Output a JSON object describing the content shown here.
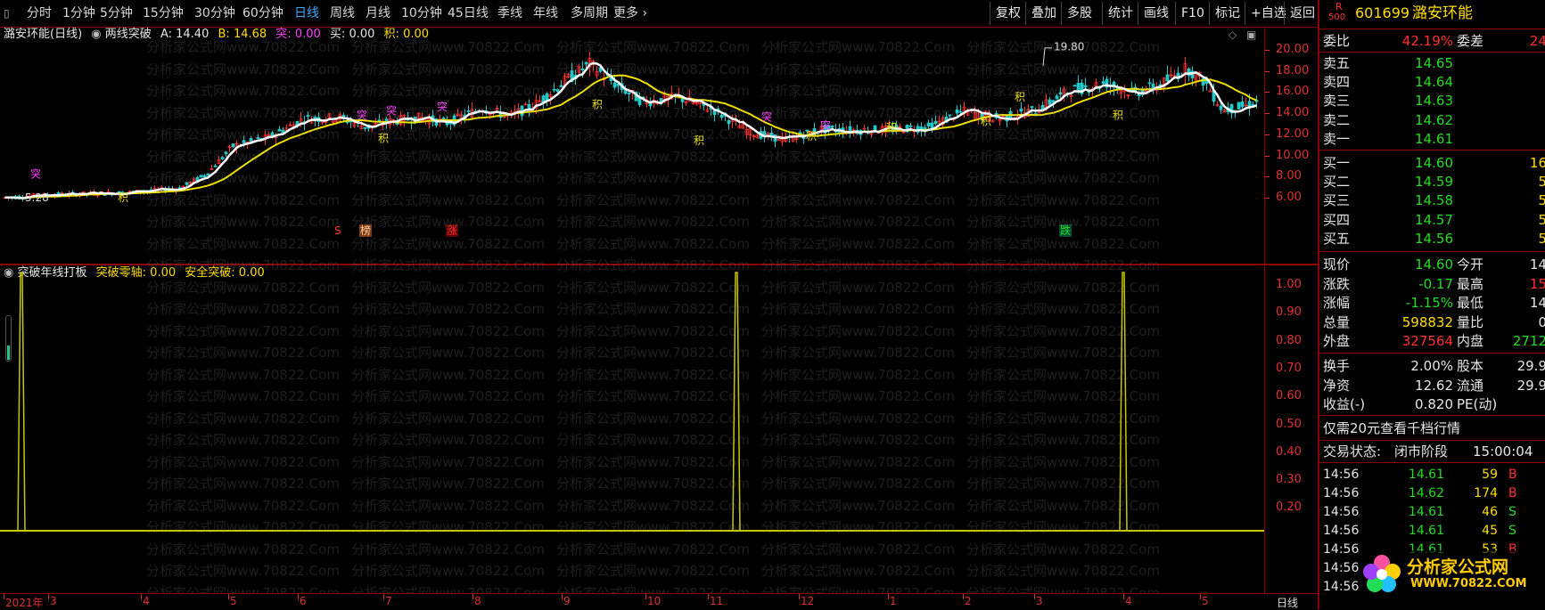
{
  "toolbar": {
    "periods": [
      "分时",
      "1分钟",
      "5分钟",
      "15分钟",
      "30分钟",
      "60分钟",
      "日线",
      "周线",
      "月线",
      "10分钟",
      "45日线",
      "季线",
      "年线",
      "多周期",
      "更多"
    ],
    "active_period": "日线",
    "right_buttons": [
      "复权",
      "叠加",
      "多股",
      "统计",
      "画线",
      "F10",
      "标记",
      "+自选",
      "返回"
    ]
  },
  "main_chart": {
    "title": "潞安环能(日线)",
    "indicator_name": "两线突破",
    "a_label": "A:",
    "a_value": "14.40",
    "b_label": "B:",
    "b_value": "14.68",
    "tu_label": "突:",
    "tu_value": "0.00",
    "mai_label": "买:",
    "mai_value": "0.00",
    "ji_label": "积:",
    "ji_value": "0.00",
    "low_label": "5.28",
    "high_label": "19.80",
    "y_ticks": [
      "20.00",
      "18.00",
      "16.00",
      "14.00",
      "12.00",
      "10.00",
      "8.00",
      "6.00"
    ],
    "markers": [
      "突",
      "突",
      "突",
      "突",
      "突",
      "突",
      "积",
      "积",
      "积",
      "积",
      "积",
      "积",
      "积",
      "积",
      "积"
    ],
    "events": [
      "S",
      "榜",
      "涨",
      "跌"
    ]
  },
  "indicator_chart": {
    "name": "突破年线打板",
    "zero_label": "突破零轴:",
    "zero_value": "0.00",
    "safe_label": "安全突破:",
    "safe_value": "0.00",
    "y_ticks": [
      "1.00",
      "0.90",
      "0.80",
      "0.70",
      "0.60",
      "0.50",
      "0.40",
      "0.30",
      "0.20"
    ]
  },
  "date_axis": {
    "labels": [
      "2021年",
      "3",
      "4",
      "5",
      "6",
      "7",
      "8",
      "9",
      "10",
      "11",
      "12",
      "1",
      "2",
      "3",
      "4",
      "5"
    ],
    "period_label": "日线"
  },
  "watermark": "分析家公式网www.70822.Com",
  "quote": {
    "r_label": "R",
    "r_sub": "500",
    "code": "601699",
    "name": "潞安环能",
    "weibi_label": "委比",
    "weibi_value": "42.19%",
    "weicha_label": "委差",
    "weicha_value": "24",
    "sells": [
      {
        "label": "卖五",
        "price": "14.65"
      },
      {
        "label": "卖四",
        "price": "14.64"
      },
      {
        "label": "卖三",
        "price": "14.63"
      },
      {
        "label": "卖二",
        "price": "14.62"
      },
      {
        "label": "卖一",
        "price": "14.61"
      }
    ],
    "buys": [
      {
        "label": "买一",
        "price": "14.60",
        "vol": "16"
      },
      {
        "label": "买二",
        "price": "14.59",
        "vol": "5"
      },
      {
        "label": "买三",
        "price": "14.58",
        "vol": "5"
      },
      {
        "label": "买四",
        "price": "14.57",
        "vol": "5"
      },
      {
        "label": "买五",
        "price": "14.56",
        "vol": "5"
      }
    ],
    "stats": [
      {
        "l1": "现价",
        "v1": "14.60",
        "l2": "今开",
        "v2": "14"
      },
      {
        "l1": "涨跌",
        "v1": "-0.17",
        "l2": "最高",
        "v2": "15"
      },
      {
        "l1": "涨幅",
        "v1": "-1.15%",
        "l2": "最低",
        "v2": "14"
      },
      {
        "l1": "总量",
        "v1": "598832",
        "l2": "量比",
        "v2": "0"
      },
      {
        "l1": "外盘",
        "v1": "327564",
        "l2": "内盘",
        "v2": "2712"
      }
    ],
    "stats2": [
      {
        "l1": "换手",
        "v1": "2.00%",
        "l2": "股本",
        "v2": "29.9"
      },
      {
        "l1": "净资",
        "v1": "12.62",
        "l2": "流通",
        "v2": "29.9"
      },
      {
        "l1": "收益(-)",
        "v1": "0.820",
        "l2": "PE(动)",
        "v2": ""
      }
    ],
    "promo": "仅需20元查看千档行情",
    "state_label": "交易状态:",
    "state_value": "闭市阶段",
    "state_time": "15:00:04",
    "ticks": [
      {
        "time": "14:56",
        "price": "14.61",
        "vol": "59",
        "side": "B"
      },
      {
        "time": "14:56",
        "price": "14.62",
        "vol": "174",
        "side": "B"
      },
      {
        "time": "14:56",
        "price": "14.61",
        "vol": "46",
        "side": "S"
      },
      {
        "time": "14:56",
        "price": "14.61",
        "vol": "45",
        "side": "S"
      },
      {
        "time": "14:56",
        "price": "14.61",
        "vol": "53",
        "side": "B"
      },
      {
        "time": "14:56",
        "price": "",
        "vol": "",
        "side": ""
      },
      {
        "time": "14:56",
        "price": "",
        "vol": "",
        "side": ""
      }
    ],
    "logo_text": "分析家公式网",
    "logo_url": "WWW.70822.COM"
  },
  "colors": {
    "up": "#ff3030",
    "down": "#22dd22",
    "ma_white": "#ffffff",
    "ma_yellow": "#f0e000",
    "indicator_line": "#c8c800",
    "border": "#8b0000",
    "active_tab": "#3fa9ff"
  }
}
